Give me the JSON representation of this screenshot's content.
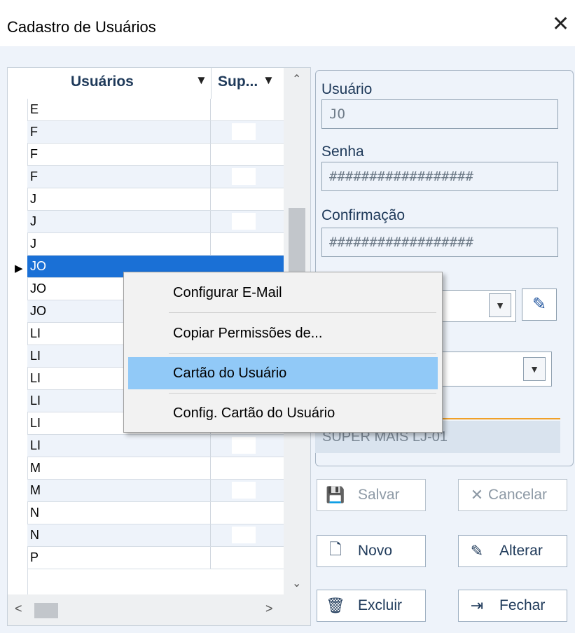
{
  "window": {
    "title": "Cadastro de Usuários",
    "close_glyph": "✕"
  },
  "grid": {
    "columns": {
      "users": "Usuários",
      "sup": "Sup...",
      "sort_arrow": "▼"
    },
    "row_pointer": "▶",
    "rows": [
      {
        "user": "E"
      },
      {
        "user": "F"
      },
      {
        "user": "F"
      },
      {
        "user": "F"
      },
      {
        "user": "J"
      },
      {
        "user": "J"
      },
      {
        "user": "J"
      },
      {
        "user": "JO"
      },
      {
        "user": "JO"
      },
      {
        "user": "JO"
      },
      {
        "user": "LI"
      },
      {
        "user": "LI"
      },
      {
        "user": "LI"
      },
      {
        "user": "LI"
      },
      {
        "user": "LI"
      },
      {
        "user": "LI"
      },
      {
        "user": "M"
      },
      {
        "user": "M"
      },
      {
        "user": "N"
      },
      {
        "user": "N"
      },
      {
        "user": "P"
      }
    ],
    "scroll": {
      "up": "⌃",
      "down": "⌄",
      "left": "<",
      "right": ">"
    }
  },
  "form": {
    "usuario_label": "Usuário",
    "usuario_value": "JO",
    "senha_label": "Senha",
    "senha_value": "##################",
    "confirmacao_label": "Confirmação",
    "confirmacao_value": "##################",
    "empresa_value": "SUPER MAIS LJ-01",
    "dropdown_glyph": "▼",
    "edit_glyph": "✎"
  },
  "buttons": {
    "salvar": "Salvar",
    "cancelar": "Cancelar",
    "novo": "Novo",
    "alterar": "Alterar",
    "excluir": "Excluir",
    "fechar": "Fechar",
    "icons": {
      "salvar": "💾",
      "cancelar": "✕",
      "novo": "🗋",
      "alterar": "✎",
      "excluir": "🗑",
      "fechar": "⇥"
    }
  },
  "context_menu": {
    "items": [
      "Configurar E-Mail",
      "Copiar Permissões de...",
      "Cartão do Usuário",
      "Config. Cartão do Usuário"
    ]
  },
  "colors": {
    "selection": "#1a70d6",
    "menu_highlight": "#91c9f7",
    "accent": "#f0a028"
  }
}
